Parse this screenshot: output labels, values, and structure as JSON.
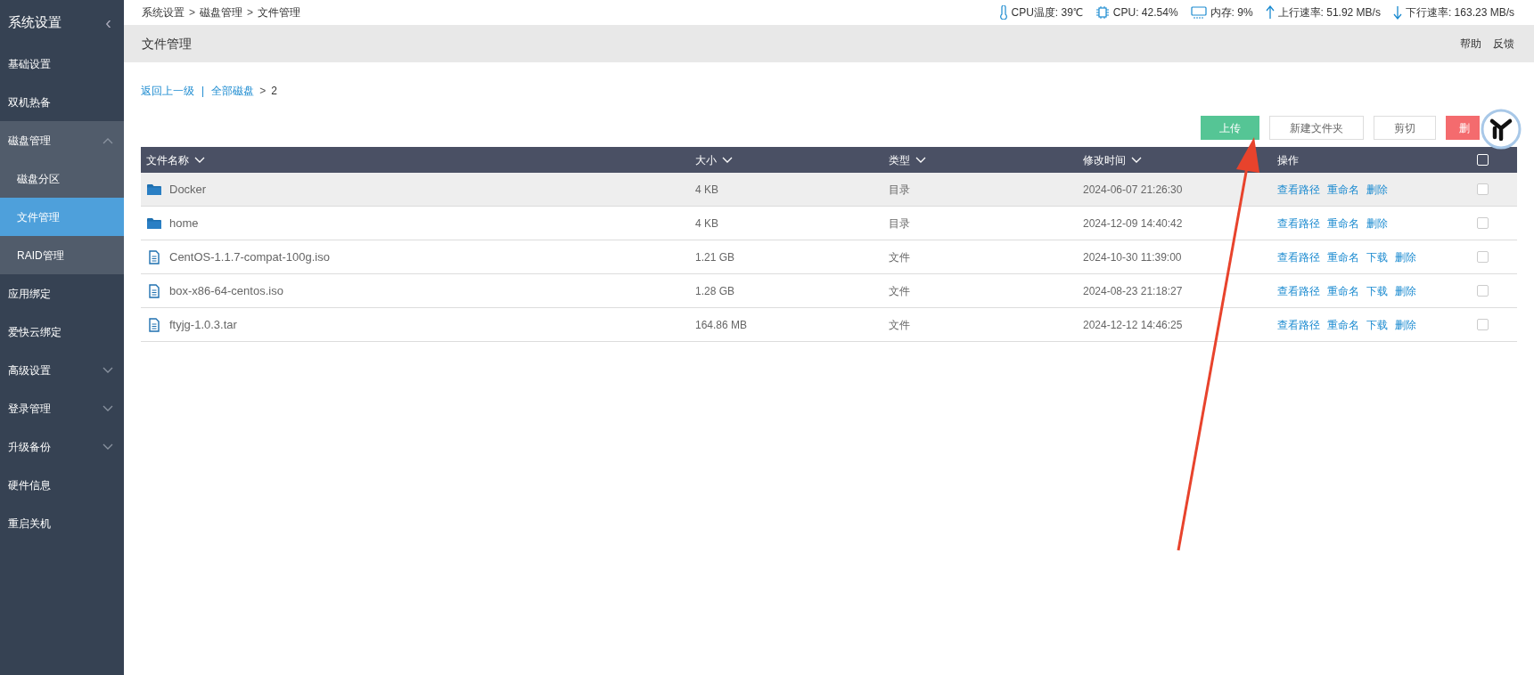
{
  "sidebar": {
    "title": "系统设置",
    "collapse_glyph": "‹",
    "items": [
      {
        "label": "基础设置",
        "selected": false
      },
      {
        "label": "双机热备",
        "selected": false
      },
      {
        "label": "磁盘管理",
        "selected": false,
        "expanded": true,
        "children": [
          {
            "label": "磁盘分区",
            "selected": false
          },
          {
            "label": "文件管理",
            "selected": true
          },
          {
            "label": "RAID管理",
            "selected": false
          }
        ]
      },
      {
        "label": "应用绑定",
        "selected": false
      },
      {
        "label": "爱快云绑定",
        "selected": false
      },
      {
        "label": "高级设置",
        "selected": false,
        "expanded": false
      },
      {
        "label": "登录管理",
        "selected": false,
        "expanded": false
      },
      {
        "label": "升级备份",
        "selected": false,
        "expanded": false
      },
      {
        "label": "硬件信息",
        "selected": false
      },
      {
        "label": "重启关机",
        "selected": false
      }
    ]
  },
  "breadcrumb": [
    "系统设置",
    "磁盘管理",
    "文件管理"
  ],
  "breadcrumb_separator": ">",
  "status": [
    {
      "kind": "temperature",
      "text": "CPU温度: 39℃"
    },
    {
      "kind": "cpu",
      "text": "CPU: 42.54%"
    },
    {
      "kind": "memory",
      "text": "内存: 9%"
    },
    {
      "kind": "upload",
      "text": "上行速率: 51.92 MB/s"
    },
    {
      "kind": "download",
      "text": "下行速率: 163.23 MB/s"
    }
  ],
  "page_title": "文件管理",
  "header_links": [
    "帮助",
    "反馈"
  ],
  "path": {
    "back": "返回上一级",
    "divider": "|",
    "root": "全部磁盘",
    "separator": ">",
    "current": "2"
  },
  "toolbar": [
    {
      "kind": "primary",
      "label": "上传"
    },
    {
      "kind": "default",
      "label": "新建文件夹"
    },
    {
      "kind": "default",
      "label": "剪切"
    },
    {
      "kind": "danger",
      "label": "删"
    }
  ],
  "table": {
    "columns": [
      {
        "label": "文件名称",
        "sortable": true
      },
      {
        "label": "大小",
        "sortable": true
      },
      {
        "label": "类型",
        "sortable": true
      },
      {
        "label": "修改时间",
        "sortable": true
      },
      {
        "label": "操作",
        "sortable": false
      }
    ],
    "select_all": {
      "checked": false
    },
    "rows": [
      {
        "kind": "folder",
        "name": "Docker",
        "size": "4 KB",
        "type": "目录",
        "modified": "2024-06-07 21:26:30",
        "actions": [
          "查看路径",
          "重命名",
          "删除"
        ],
        "hovered": true,
        "checked": false
      },
      {
        "kind": "folder",
        "name": "home",
        "size": "4 KB",
        "type": "目录",
        "modified": "2024-12-09 14:40:42",
        "actions": [
          "查看路径",
          "重命名",
          "删除"
        ],
        "hovered": false,
        "checked": false
      },
      {
        "kind": "file",
        "name": "CentOS-1.1.7-compat-100g.iso",
        "size": "1.21 GB",
        "type": "文件",
        "modified": "2024-10-30 11:39:00",
        "actions": [
          "查看路径",
          "重命名",
          "下载",
          "删除"
        ],
        "hovered": false,
        "checked": false
      },
      {
        "kind": "file",
        "name": "box-x86-64-centos.iso",
        "size": "1.28 GB",
        "type": "文件",
        "modified": "2024-08-23 21:18:27",
        "actions": [
          "查看路径",
          "重命名",
          "下载",
          "删除"
        ],
        "hovered": false,
        "checked": false
      },
      {
        "kind": "file",
        "name": "ftyjg-1.0.3.tar",
        "size": "164.86 MB",
        "type": "文件",
        "modified": "2024-12-12 14:46:25",
        "actions": [
          "查看路径",
          "重命名",
          "下载",
          "删除"
        ],
        "hovered": false,
        "checked": false
      }
    ]
  }
}
